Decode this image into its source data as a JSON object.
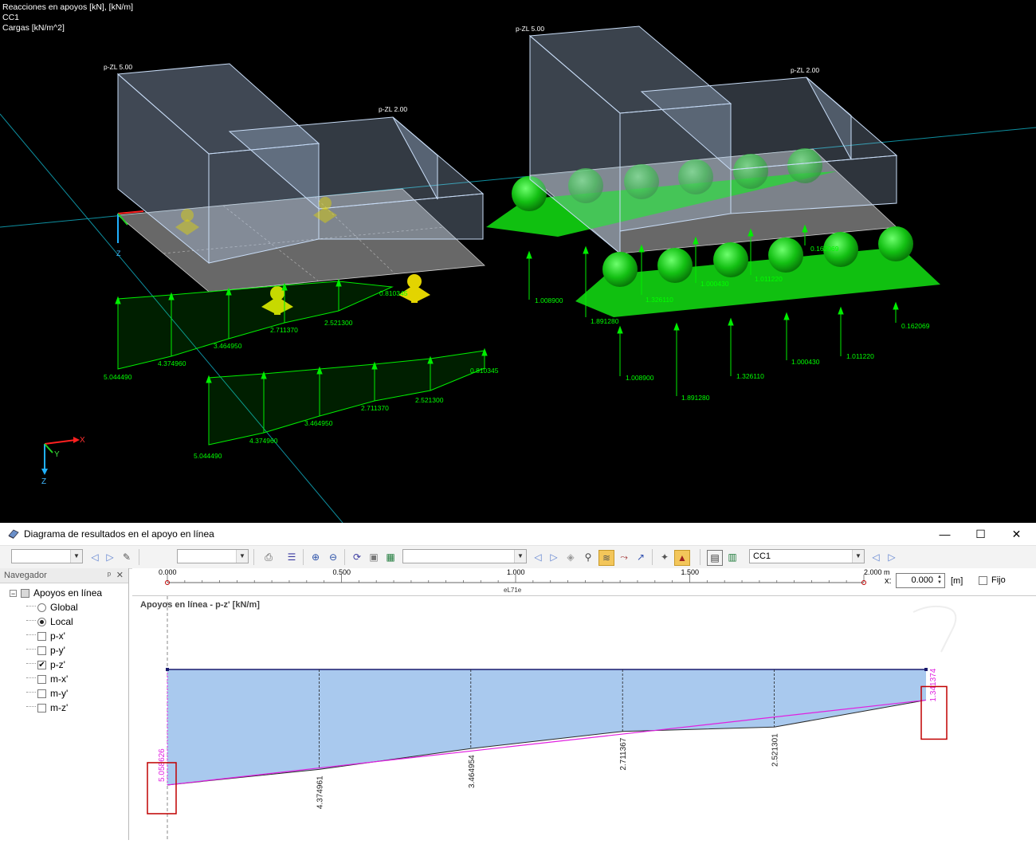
{
  "viewport": {
    "info_lines": [
      "Reacciones en apoyos [kN], [kN/m]",
      "CC1",
      "Cargas [kN/m^2]"
    ],
    "load_labels": [
      "p-ZL 5.00",
      "p-ZL 2.00",
      "p-ZL 5.00",
      "p-ZL 2.00"
    ],
    "axis": {
      "x": "X",
      "y": "Y",
      "z": "Z"
    },
    "colors": {
      "background": "#000000",
      "reaction": "#00ff00",
      "support": "#00cc00",
      "load_box": "#b8cff0",
      "slab": "#8a8a8a",
      "yellow_support": "#e0d000"
    },
    "left_diagram_1_values": [
      "5.044490",
      "4.374960",
      "3.464950",
      "2.711370",
      "2.521300",
      "0.810345"
    ],
    "left_diagram_2_values": [
      "5.044490",
      "4.374960",
      "3.464950",
      "2.711370",
      "2.521300",
      "0.810345"
    ],
    "right_arrows_top": [
      "1.008900",
      "1.891280",
      "1.326110",
      "1.000430",
      "1.011220",
      "0.162069"
    ],
    "right_arrows_bottom": [
      "1.008900",
      "1.891280",
      "1.326110",
      "1.000430",
      "1.011220",
      "0.162069"
    ]
  },
  "panel": {
    "title": "Diagrama de resultados en el apoyo en línea",
    "window_buttons": {
      "minimize": "—",
      "maximize": "☐",
      "close": "✕"
    },
    "toolbar": {
      "load_case": "CC1"
    },
    "navigator": {
      "title": "Navegador",
      "pin": "ᵖ",
      "close": "✕",
      "root": "Apoyos en línea",
      "options": [
        {
          "label": "Global",
          "checked": false,
          "kind": "radio"
        },
        {
          "label": "Local",
          "checked": true,
          "kind": "radio"
        },
        {
          "label": "p-x'",
          "checked": false,
          "kind": "check"
        },
        {
          "label": "p-y'",
          "checked": false,
          "kind": "check"
        },
        {
          "label": "p-z'",
          "checked": true,
          "kind": "check"
        },
        {
          "label": "m-x'",
          "checked": false,
          "kind": "check"
        },
        {
          "label": "m-y'",
          "checked": false,
          "kind": "check"
        },
        {
          "label": "m-z'",
          "checked": false,
          "kind": "check"
        }
      ]
    },
    "ruler": {
      "ticks": [
        "0.000",
        "0.500",
        "1.000",
        "1.500",
        "2.000 m"
      ],
      "member_label": "eL71e",
      "x_label": "x:",
      "x_value": "0.000",
      "x_unit": "[m]",
      "fixed_label": "Fijo"
    },
    "diagram": {
      "title": "Apoyos en línea - p-z' [kN/m]",
      "values": [
        "5.058626",
        "4.374961",
        "3.464954",
        "2.711367",
        "2.521301",
        "1.341374"
      ],
      "colors": {
        "fill": "#a9c9ee",
        "line": "#1a1a6e",
        "trend": "#e020e0",
        "highlight": "#c00000"
      }
    }
  },
  "chart_data": {
    "type": "area",
    "title": "Apoyos en línea - p-z' [kN/m]",
    "xlabel": "x [m]",
    "ylabel": "p-z' [kN/m]",
    "x": [
      0.0,
      0.4,
      0.8,
      1.2,
      1.6,
      2.0
    ],
    "series": [
      {
        "values": [
          5.058626,
          4.374961,
          3.464954,
          2.711367,
          2.521301,
          1.341374
        ]
      }
    ],
    "trend_line": {
      "x": [
        0.0,
        2.0
      ],
      "values": [
        5.058626,
        1.341374
      ]
    },
    "xlim": [
      0.0,
      2.0
    ],
    "ylim": [
      0,
      5.06
    ]
  }
}
